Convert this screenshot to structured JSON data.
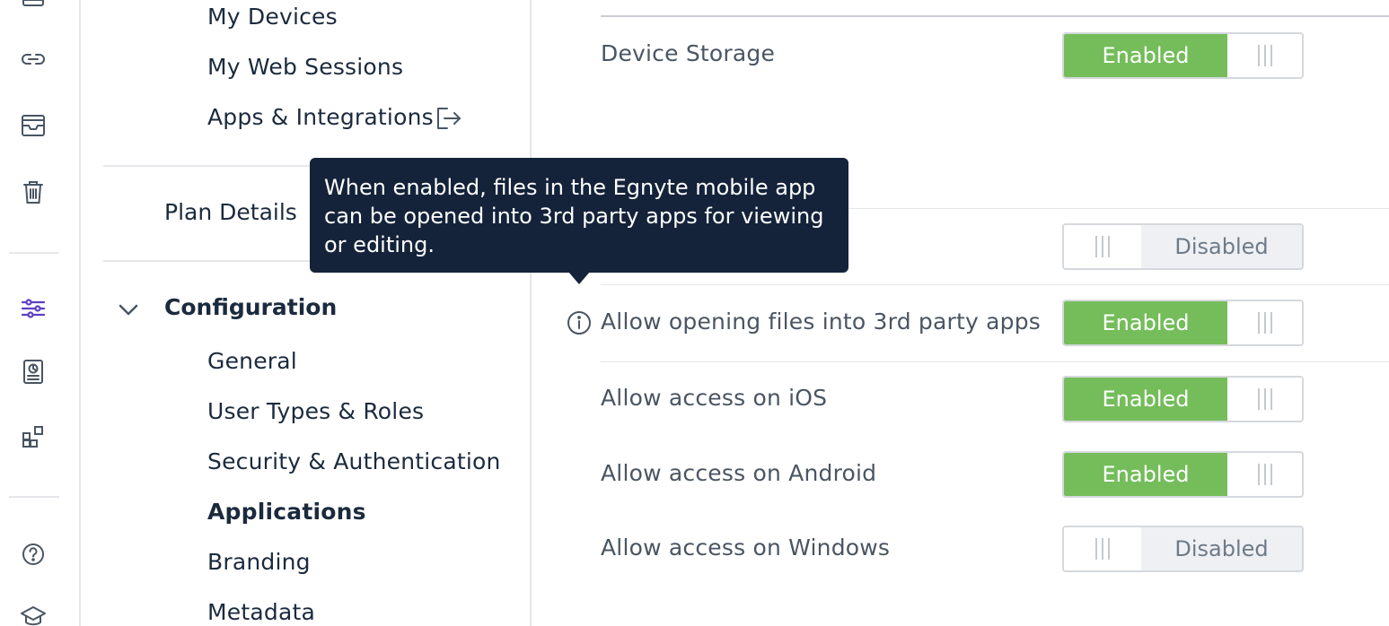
{
  "rail": {
    "icons": [
      "link-icon",
      "inbox-icon",
      "trash-icon",
      "settings-sliders-icon",
      "reports-icon",
      "apps-icon",
      "help-icon",
      "academy-icon"
    ],
    "active_icon": "settings-sliders-icon",
    "active_color": "#5b3fc4"
  },
  "nav": {
    "account_items": [
      {
        "label": "My Devices"
      },
      {
        "label": "My Web Sessions"
      },
      {
        "label": "Apps & Integrations"
      }
    ],
    "plan_details": "Plan Details",
    "configuration": {
      "label": "Configuration",
      "expanded": true,
      "items": [
        {
          "label": "General"
        },
        {
          "label": "User Types & Roles"
        },
        {
          "label": "Security & Authentication"
        },
        {
          "label": "Applications",
          "active": true
        },
        {
          "label": "Branding"
        },
        {
          "label": "Metadata"
        }
      ]
    }
  },
  "settings": [
    {
      "label": "Device Storage",
      "state": "Enabled"
    },
    {
      "label": "",
      "state": "Disabled"
    },
    {
      "label": "Allow opening files into 3rd party apps",
      "state": "Enabled",
      "has_info": true
    },
    {
      "label": "Allow access on iOS",
      "state": "Enabled"
    },
    {
      "label": "Allow access on Android",
      "state": "Enabled"
    },
    {
      "label": "Allow access on Windows",
      "state": "Disabled"
    }
  ],
  "tooltip": {
    "text": "When enabled, files in the Egnyte mobile app can be opened into 3rd party apps for viewing or editing."
  },
  "colors": {
    "enabled": "#74bd5a",
    "disabled_bg": "#eef0f3",
    "tooltip_bg": "#14233a"
  }
}
